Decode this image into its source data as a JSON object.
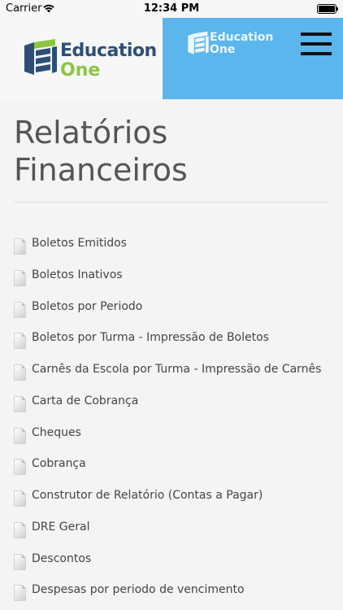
{
  "status_bar": {
    "carrier": "Carrier",
    "time": "12:34 PM"
  },
  "header": {
    "logo_word1": "Education",
    "logo_word2": "One",
    "logo_small_word1": "Education",
    "logo_small_word2": "One",
    "colors": {
      "banner": "#5ab6ec",
      "logo_blue": "#2d4f77",
      "logo_green": "#8cc63f"
    }
  },
  "page": {
    "title": "Relatórios Financeiros",
    "reports": [
      {
        "label": "Boletos Emitidos",
        "icon": "document-icon"
      },
      {
        "label": "Boletos Inativos",
        "icon": "document-icon"
      },
      {
        "label": "Boletos por Periodo",
        "icon": "document-icon"
      },
      {
        "label": "Boletos por Turma - Impressão de Boletos",
        "icon": "document-icon"
      },
      {
        "label": "Carnês da Escola por Turma - Impressão de Carnês",
        "icon": "document-icon"
      },
      {
        "label": "Carta de Cobrança",
        "icon": "document-icon"
      },
      {
        "label": "Cheques",
        "icon": "document-icon"
      },
      {
        "label": "Cobrança",
        "icon": "document-icon"
      },
      {
        "label": "Construtor de Relatório (Contas a Pagar)",
        "icon": "document-icon"
      },
      {
        "label": "DRE Geral",
        "icon": "document-icon"
      },
      {
        "label": "Descontos",
        "icon": "document-icon"
      },
      {
        "label": "Despesas por periodo de vencimento",
        "icon": "document-icon"
      }
    ]
  }
}
